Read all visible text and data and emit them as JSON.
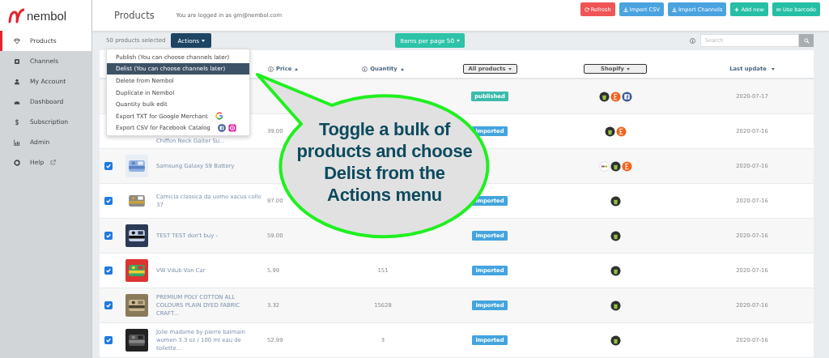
{
  "logo": {
    "text": "nembol"
  },
  "sidebar": {
    "items": [
      {
        "label": "Products",
        "selected": true
      },
      {
        "label": "Channels",
        "selected": false
      },
      {
        "label": "My Account",
        "selected": false
      },
      {
        "label": "Dashboard",
        "selected": false
      },
      {
        "label": "Subscription",
        "selected": false
      },
      {
        "label": "Admin",
        "selected": false
      },
      {
        "label": "Help",
        "selected": false,
        "external": true
      }
    ]
  },
  "header": {
    "title": "Products",
    "login_note": "You are logged in as gm@nembol.com",
    "buttons": [
      {
        "label": "Refresh",
        "kind": "refresh"
      },
      {
        "label": "Import CSV",
        "kind": "import"
      },
      {
        "label": "Import Channels",
        "kind": "import"
      },
      {
        "label": "Add new",
        "kind": "add"
      },
      {
        "label": "Use barcode",
        "kind": "barcode"
      }
    ]
  },
  "toolbar": {
    "selection": "50 products selected",
    "actions_button": "Actions",
    "per_page_button": "Items per page 50",
    "search": {
      "placeholder": "Search"
    }
  },
  "actions_menu": {
    "items": [
      {
        "label": "Publish (You can choose channels later)",
        "selected": false
      },
      {
        "label": "Delist (You can choose channels later)",
        "selected": true
      },
      {
        "label": "Delete from Nembol",
        "selected": false
      },
      {
        "label": "Duplicate in Nembol",
        "selected": false
      },
      {
        "label": "Quantity bulk edit",
        "selected": false
      },
      {
        "label": "Export TXT for Google Merchant",
        "selected": false,
        "badges": [
          {
            "kind": "google"
          }
        ]
      },
      {
        "label": "Export CSV for Facebook Catalog",
        "selected": false,
        "badges": [
          {
            "kind": "facebook"
          },
          {
            "kind": "instagram"
          }
        ]
      }
    ]
  },
  "table": {
    "columns": {
      "price": "Price",
      "quantity": "Quantity",
      "status_filter": "All products",
      "channel_filter": "Shopify",
      "last_update": "Last update"
    },
    "rows": [
      {
        "status": {
          "text": "published",
          "kind": "published"
        },
        "channels": [
          {
            "kind": "shopify"
          },
          {
            "kind": "etsy"
          },
          {
            "kind": "facebook"
          }
        ],
        "last_update": "2020-07-17"
      },
      {
        "name": "Chiffon Neck Gaiter Su...",
        "price": "39.00",
        "status": {
          "text": "imported",
          "kind": "imported"
        },
        "channels": [
          {
            "kind": "shopify"
          },
          {
            "kind": "etsy"
          }
        ],
        "last_update": "2020-07-16"
      },
      {
        "checked": true,
        "thumb": {
          "kind": "picture"
        },
        "name": "Samsung Galaxy S9 Battery",
        "channels": [
          {
            "kind": "ebay"
          },
          {
            "kind": "shopify"
          },
          {
            "kind": "etsy"
          }
        ],
        "last_update": "2020-07-16"
      },
      {
        "checked": true,
        "thumb": {
          "kind": "picture"
        },
        "name": "Camicia classica da uomo xacus collo 37",
        "price": "97.00",
        "status": {
          "text": "imported",
          "kind": "imported"
        },
        "channels": [
          {
            "kind": "shopify"
          }
        ],
        "last_update": "2020-07-16"
      },
      {
        "checked": true,
        "thumb": {
          "kind": "picture"
        },
        "name": "TEST TEST don't buy -",
        "price": "59.00",
        "status": {
          "text": "imported",
          "kind": "imported"
        },
        "channels": [
          {
            "kind": "shopify"
          }
        ],
        "last_update": "2020-07-16"
      },
      {
        "checked": true,
        "thumb": {
          "kind": "picture"
        },
        "name": "VW Vdub Van Car",
        "price": "5.99",
        "quantity": "151",
        "status": {
          "text": "imported",
          "kind": "imported"
        },
        "channels": [
          {
            "kind": "shopify"
          }
        ],
        "last_update": "2020-07-16"
      },
      {
        "checked": true,
        "thumb": {
          "kind": "picture"
        },
        "name": "PREMIUM POLY COTTON ALL COLOURS PLAIN DYED FABRIC CRAFT...",
        "price": "3.32",
        "quantity": "15628",
        "status": {
          "text": "imported",
          "kind": "imported"
        },
        "channels": [
          {
            "kind": "shopify"
          }
        ],
        "last_update": "2020-07-16"
      },
      {
        "checked": true,
        "thumb": {
          "kind": "picture"
        },
        "name": "Jolie madame by pierre balmain women 3.3 oz / 100 ml eau de toilette...",
        "price": "52.99",
        "quantity": "3",
        "status": {
          "text": "imported",
          "kind": "imported"
        },
        "channels": [
          {
            "kind": "shopify"
          }
        ],
        "last_update": "2020-07-16"
      }
    ]
  },
  "callout": {
    "text": "Toggle a bulk of products and choose Delist from the Actions menu"
  }
}
